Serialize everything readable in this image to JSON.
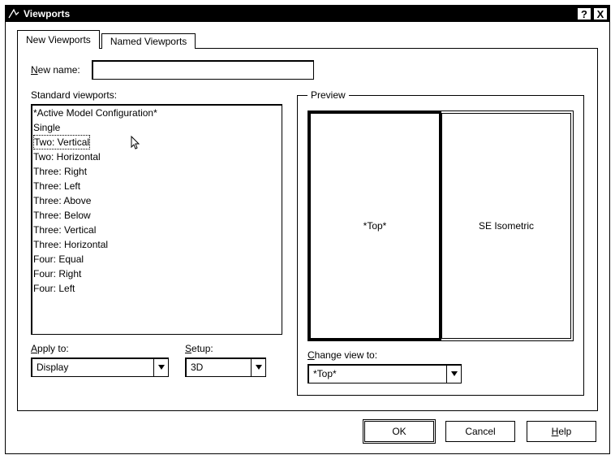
{
  "title": "Viewports",
  "help_glyph": "?",
  "close_glyph": "X",
  "tabs": [
    {
      "label": "New Viewports",
      "active": true
    },
    {
      "label": "Named Viewports",
      "active": false
    }
  ],
  "newname": {
    "label": "New name:",
    "value": ""
  },
  "standard": {
    "label": "Standard viewports:",
    "items": [
      "*Active Model Configuration*",
      "Single",
      "Two:   Vertical",
      "Two:   Horizontal",
      "Three: Right",
      "Three: Left",
      "Three: Above",
      "Three: Below",
      "Three: Vertical",
      "Three: Horizontal",
      "Four:  Equal",
      "Four:  Right",
      "Four:  Left"
    ],
    "selected_index": 2
  },
  "apply": {
    "label": "Apply to:",
    "value": "Display"
  },
  "setup": {
    "label": "Setup:",
    "value": "3D"
  },
  "preview": {
    "label": "Preview",
    "panes": [
      {
        "label": "*Top*",
        "selected": true
      },
      {
        "label": "SE Isometric",
        "selected": false
      }
    ]
  },
  "change": {
    "label": "Change view to:",
    "value": "*Top*"
  },
  "buttons": {
    "ok": "OK",
    "cancel": "Cancel",
    "help": "Help"
  }
}
